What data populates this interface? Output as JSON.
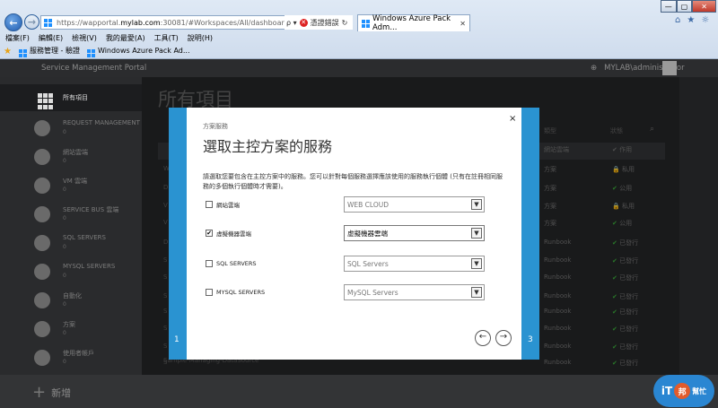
{
  "browser": {
    "url_prefix": "https://wapportal.",
    "url_host": "mylab.com",
    "url_rest": ":30081/#Workspaces/All/dashboard",
    "search_symbol": "ρ ▾",
    "cert_error": "憑證錯誤",
    "tab_title": "Windows Azure Pack Adm...",
    "tab_close": "✕",
    "window_controls": [
      "—",
      "▢",
      "✕"
    ],
    "tools": [
      "⌂",
      "★",
      "☼"
    ],
    "menu": [
      "檔案(F)",
      "編輯(E)",
      "檢視(V)",
      "我的最愛(A)",
      "工具(T)",
      "說明(H)"
    ],
    "favorites": [
      "服務管理 - 驗證",
      "Windows Azure Pack Ad..."
    ]
  },
  "portal": {
    "brand": "Service Management Portal",
    "user": "MYLAB\\administrator",
    "page_title": "所有項目",
    "columns": {
      "type": "類型",
      "status": "狀態"
    },
    "sidebar": [
      {
        "label": "所有項目",
        "count": ""
      },
      {
        "label": "REQUEST MANAGEMENT",
        "count": "0"
      },
      {
        "label": "網站雲端",
        "count": "0"
      },
      {
        "label": "VM 雲端",
        "count": "0"
      },
      {
        "label": "SERVICE BUS 雲端",
        "count": "0"
      },
      {
        "label": "SQL SERVERS",
        "count": "0"
      },
      {
        "label": "MYSQL SERVERS",
        "count": "0"
      },
      {
        "label": "自動化",
        "count": "0"
      },
      {
        "label": "方案",
        "count": "0"
      },
      {
        "label": "使用者帳戶",
        "count": "0"
      }
    ],
    "rows": [
      {
        "name": "",
        "type": "網站雲端",
        "status": "✔ 作用"
      },
      {
        "name": "W",
        "type": "方案",
        "status_icon": "🔒",
        "status": "私用"
      },
      {
        "name": "D",
        "type": "方案",
        "status_icon": "✔",
        "status": "公用"
      },
      {
        "name": "V",
        "type": "方案",
        "status_icon": "🔒",
        "status": "私用"
      },
      {
        "name": "V",
        "type": "方案",
        "status_icon": "✔",
        "status": "公用"
      },
      {
        "name": "D",
        "type": "Runbook",
        "status_icon": "✔",
        "status": "已發行"
      },
      {
        "name": "S",
        "type": "Runbook",
        "status_icon": "✔",
        "status": "已發行"
      },
      {
        "name": "S",
        "type": "Runbook",
        "status_icon": "✔",
        "status": "已發行"
      },
      {
        "name": "S",
        "type": "Runbook",
        "status_icon": "✔",
        "status": "已發行"
      },
      {
        "name": "S",
        "type": "Runbook",
        "status_icon": "✔",
        "status": "已發行"
      },
      {
        "name": "S",
        "type": "Runbook",
        "status_icon": "✔",
        "status": "已發行"
      },
      {
        "name": "S",
        "type": "Runbook",
        "status_icon": "✔",
        "status": "已發行"
      },
      {
        "name": "S",
        "type": "Runbook",
        "status_icon": "✔",
        "status": "已發行"
      },
      {
        "name": "Sample-Managing-DataSource",
        "type": "Runbook",
        "status_icon": "✔",
        "status": "已發行"
      }
    ],
    "add_label": "新增",
    "watermark": [
      "iT",
      "邦",
      "幫忙"
    ]
  },
  "dialog": {
    "close": "×",
    "subtitle": "方案服務",
    "title": "選取主控方案的服務",
    "description": "請選取您要包含在主控方案中的服務。您可以針對每個服務選擇應該使用的服務執行個體 (只有在註冊相同服務的多個執行個體時才需要)。",
    "options": [
      {
        "label": "網站雲端",
        "checked": "",
        "value": "WEB CLOUD"
      },
      {
        "label": "虛擬機器雲端",
        "checked": "✔",
        "value": "虛擬機器雲端"
      },
      {
        "label": "SQL SERVERS",
        "checked": "",
        "value": "SQL Servers"
      },
      {
        "label": "MYSQL SERVERS",
        "checked": "",
        "value": "MySQL Servers"
      }
    ],
    "select_arrow": "▼",
    "step_left": "1",
    "step_right": "3",
    "prev": "←",
    "next": "→"
  }
}
